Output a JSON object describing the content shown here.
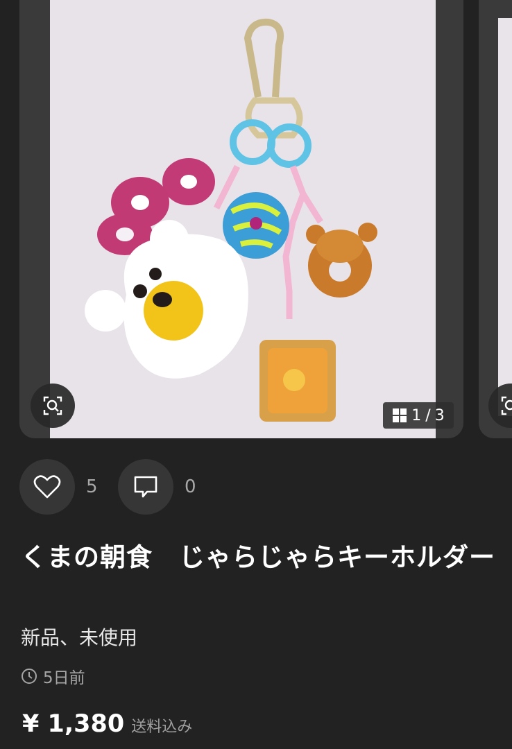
{
  "gallery": {
    "current_page": "1",
    "separator": "/",
    "total_pages": "3",
    "photo_background": "#e8e2e9"
  },
  "engagement": {
    "likes_count": "5",
    "comments_count": "0"
  },
  "item": {
    "title": "くまの朝食　じゃらじゃらキーホルダー",
    "condition": "新品、未使用",
    "posted": "5日前",
    "price": "¥ 1,380",
    "shipping_note": "送料込み"
  },
  "icons": [
    "zoom-icon",
    "grid-icon",
    "heart-icon",
    "comment-icon",
    "clock-icon"
  ]
}
